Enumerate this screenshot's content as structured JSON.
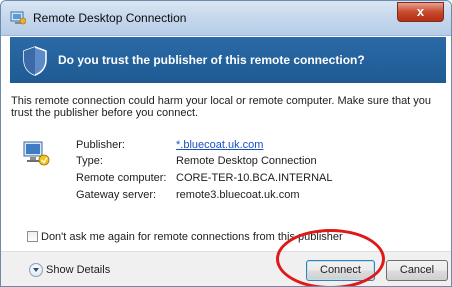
{
  "window": {
    "title": "Remote Desktop Connection",
    "close_glyph": "x"
  },
  "banner": {
    "text": "Do you trust the publisher of this remote connection?"
  },
  "warning": {
    "text": "This remote connection could harm your local or remote computer. Make sure that you trust the publisher before you connect."
  },
  "details": [
    {
      "label": "Publisher:",
      "value": "*.bluecoat.uk.com",
      "link": true
    },
    {
      "label": "Type:",
      "value": "Remote Desktop Connection",
      "link": false
    },
    {
      "label": "Remote computer:",
      "value": "CORE-TER-10.BCA.INTERNAL",
      "link": false
    },
    {
      "label": "Gateway server:",
      "value": "remote3.bluecoat.uk.com",
      "link": false
    }
  ],
  "checkbox": {
    "label": "Don't ask me again for remote connections from this publisher",
    "checked": false
  },
  "footer": {
    "show_details_label": "Show Details",
    "connect_label": "Connect",
    "cancel_label": "Cancel"
  },
  "icons": {
    "app": "remote-desktop-icon",
    "shield": "shield-icon",
    "computer": "computer-icon",
    "expand": "chevron-down-icon"
  },
  "colors": {
    "banner": "#1f5a93",
    "annotation": "#e01818",
    "close": "#c74a2e",
    "link": "#1a4fc4"
  }
}
